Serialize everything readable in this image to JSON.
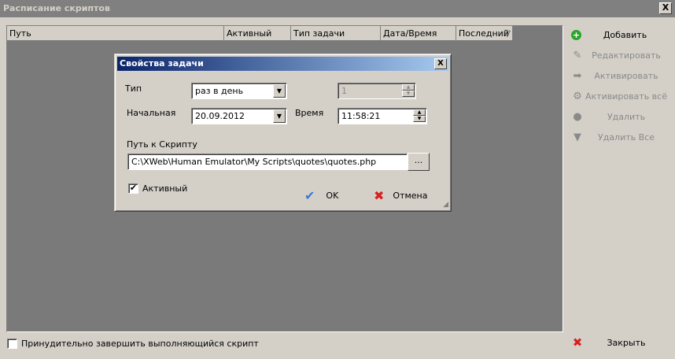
{
  "window": {
    "title": "Расписание скриптов",
    "close": "X"
  },
  "list": {
    "columns": [
      "Путь",
      "Активный",
      "Тип задачи",
      "Дата/Время",
      "Последний"
    ],
    "sort_icon": "filter-icon"
  },
  "actions": [
    {
      "label": "Добавить",
      "icon": "add-icon",
      "enabled": true
    },
    {
      "label": "Редактировать",
      "icon": "edit-icon",
      "enabled": false
    },
    {
      "label": "Активировать",
      "icon": "activate-icon",
      "enabled": false
    },
    {
      "label": "Активировать всё",
      "icon": "activate-all-icon",
      "enabled": false
    },
    {
      "label": "Удалить",
      "icon": "delete-icon",
      "enabled": false
    },
    {
      "label": "Удалить Все",
      "icon": "delete-all-icon",
      "enabled": false
    }
  ],
  "close_button": {
    "label": "Закрыть",
    "icon": "close-x-icon"
  },
  "force_stop": {
    "label": "Принудительно завершить выполняющийся скрипт",
    "checked": false
  },
  "dialog": {
    "title": "Свойства задачи",
    "close": "X",
    "type_label": "Тип",
    "type_value": "раз в день",
    "count_value": "1",
    "start_label": "Начальная",
    "start_value": "20.09.2012",
    "time_label": "Время",
    "time_value": "11:58:21",
    "path_label": "Путь к Скрипту",
    "path_value": "C:\\XWeb\\Human Emulator\\My Scripts\\quotes\\quotes.php",
    "browse_label": "...",
    "active_label": "Активный",
    "active_checked": true,
    "ok_label": "OK",
    "cancel_label": "Отмена"
  },
  "colors": {
    "list_bg": "#7a7a7a",
    "dialog_title": "#0a246a",
    "add_green": "#2aa52a",
    "cancel_red": "#d82020",
    "ok_blue": "#3a7bd5"
  }
}
